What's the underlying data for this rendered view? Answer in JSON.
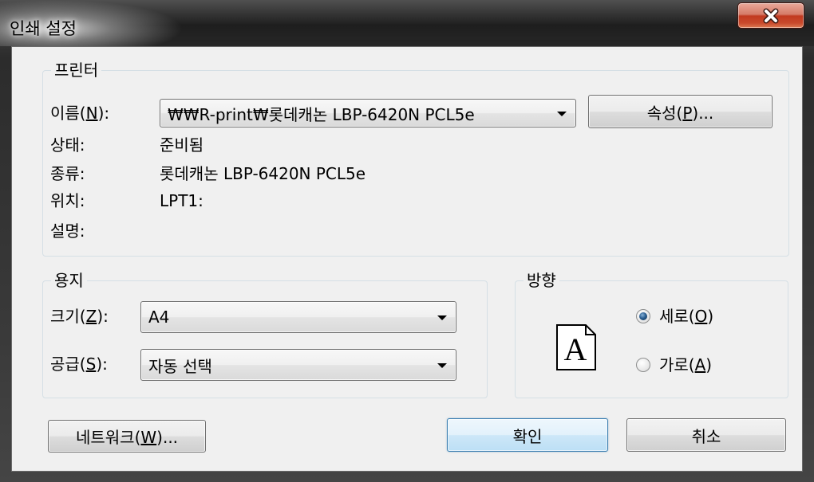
{
  "window": {
    "title": "인쇄 설정",
    "close_icon": "close-icon"
  },
  "printer": {
    "group_label": "프린터",
    "name_label": "이름(N):",
    "name_value": "₩₩R-print₩롯데캐논 LBP-6420N PCL5e",
    "properties_button": "속성(P)...",
    "status_label": "상태:",
    "status_value": "준비됨",
    "type_label": "종류:",
    "type_value": "롯데캐논 LBP-6420N PCL5e",
    "location_label": "위치:",
    "location_value": "LPT1:",
    "comment_label": "설명:"
  },
  "paper": {
    "group_label": "용지",
    "size_label": "크기(Z):",
    "size_value": "A4",
    "source_label": "공급(S):",
    "source_value": "자동 선택"
  },
  "orientation": {
    "group_label": "방향",
    "page_icon": "portrait-page-icon",
    "page_icon_letter": "A",
    "portrait_label": "세로(O)",
    "portrait_checked": true,
    "landscape_label": "가로(A)",
    "landscape_checked": false
  },
  "buttons": {
    "network": "네트워크(W)...",
    "ok": "확인",
    "cancel": "취소"
  },
  "icons": {
    "dropdown": "chevron-down-icon",
    "radio": "radio-icon"
  },
  "colors": {
    "title_bar": "#2a2a2a",
    "close_button": "#c8432f",
    "dialog_background": "#f0f0f0",
    "group_border": "#d5dfe5",
    "default_button_border": "#3c7fb1",
    "text": "#000000"
  }
}
